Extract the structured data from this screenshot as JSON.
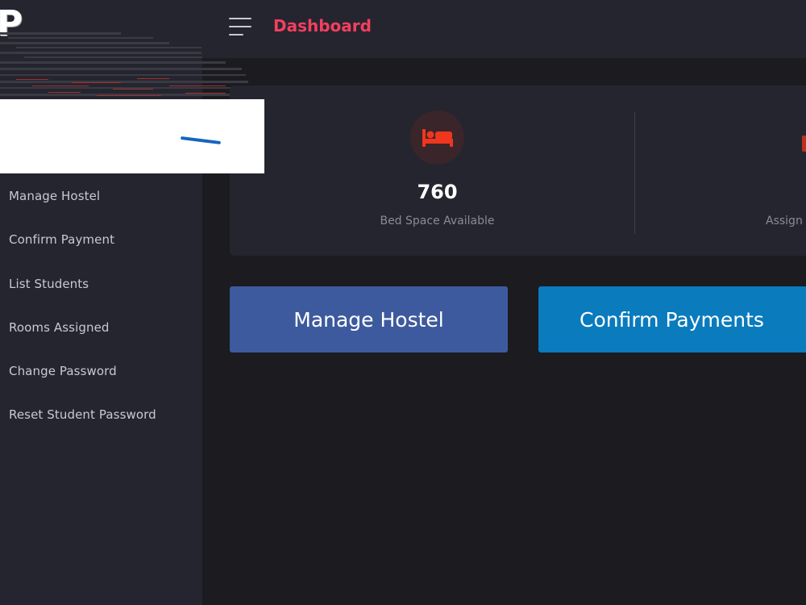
{
  "header": {
    "title": "Dashboard",
    "menu_icon": "hamburger-icon"
  },
  "sidebar": {
    "logo_letter": "P",
    "items": [
      {
        "label": "Manage Hostel"
      },
      {
        "label": "Confirm Payment"
      },
      {
        "label": "List Students"
      },
      {
        "label": "Rooms Assigned"
      },
      {
        "label": "Change Password"
      },
      {
        "label": "Reset Student Password"
      }
    ]
  },
  "stats": [
    {
      "value": "760",
      "label": "Bed Space Available",
      "icon": "bed-icon",
      "icon_color": "#f0361f"
    },
    {
      "value": "",
      "label": "Assign",
      "icon": "partial-icon"
    }
  ],
  "actions": {
    "manage_hostel": "Manage Hostel",
    "confirm_payments": "Confirm Payments"
  },
  "colors": {
    "accent": "#f43f5e",
    "sidebar_bg": "#25252f",
    "main_bg": "#1b1b20",
    "manage_hostel_btn": "#3d5a9e",
    "confirm_payments_btn": "#0a7bbd"
  }
}
